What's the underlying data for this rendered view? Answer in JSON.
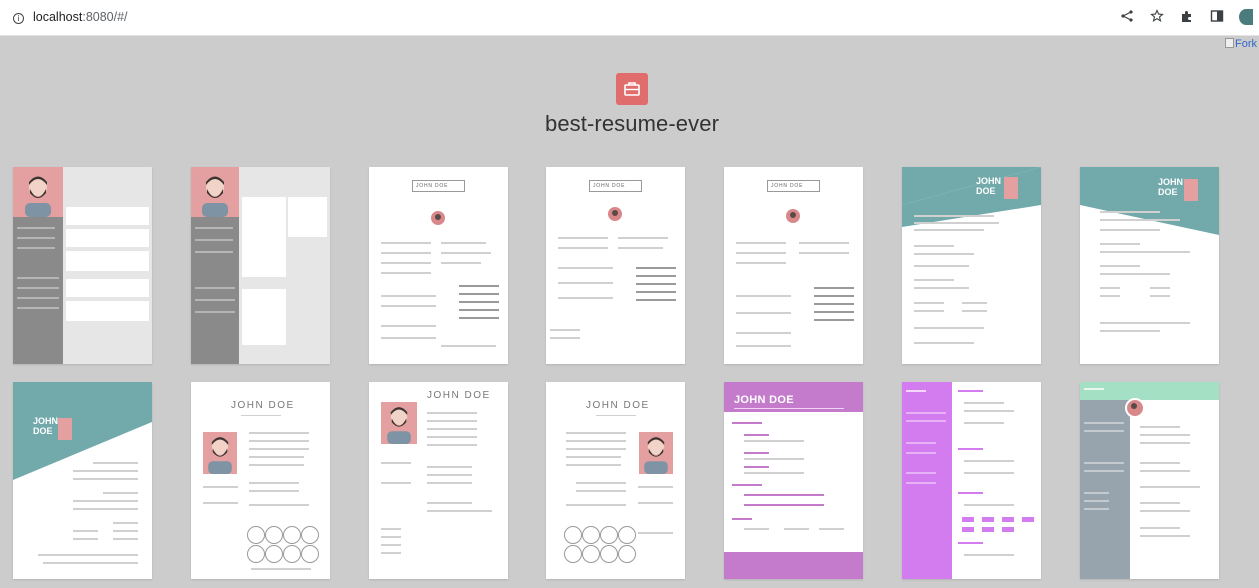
{
  "browser": {
    "url_host": "localhost",
    "url_rest": ":8080/#/",
    "broken_image_alt": "Fork"
  },
  "page": {
    "title": "best-resume-ever"
  },
  "colors": {
    "logo": "#e06c6c",
    "teal": "#72a9aa",
    "purple": "#c47bcb",
    "violet": "#d27cf0",
    "mint": "#a3e0c4",
    "slate": "#98a4ad"
  },
  "cards": [
    {
      "name": "JOHN DOE"
    },
    {
      "name": "JOHN DOE"
    },
    {
      "name": "JOHN DOE"
    },
    {
      "name": "JOHN DOE"
    },
    {
      "name": "JOHN DOE"
    },
    {
      "name": "JOHN DOE"
    },
    {
      "name": "JOHN DOE"
    },
    {
      "name": "JOHN DOE"
    },
    {
      "name": "JOHN DOE"
    },
    {
      "name": "JOHN DOE"
    },
    {
      "name": "JOHN DOE"
    },
    {
      "name": "JOHN DOE"
    },
    {
      "name": "JOHN DOE"
    },
    {
      "name": "JOHN DOE"
    }
  ]
}
